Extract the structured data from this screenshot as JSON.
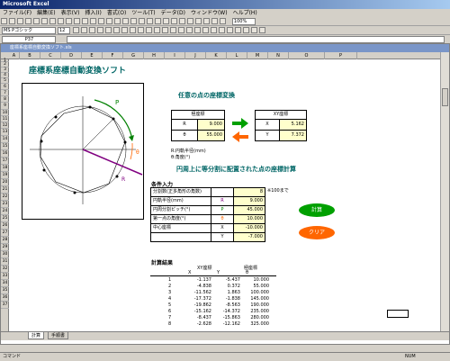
{
  "window": {
    "title": "Microsoft Excel",
    "doc_title": "座標系座標自動変換ソフト.xls"
  },
  "menu": [
    "ファイル(F)",
    "編集(E)",
    "表示(V)",
    "挿入(I)",
    "書式(O)",
    "ツール(T)",
    "データ(D)",
    "ウィンドウ(W)",
    "ヘルプ(H)"
  ],
  "toolbar": {
    "zoom": "100%",
    "font": "MS Pゴシック",
    "size": "12"
  },
  "formula": {
    "namebox": "P37",
    "value": ""
  },
  "columns": [
    "A",
    "B",
    "C",
    "D",
    "E",
    "F",
    "G",
    "H",
    "I",
    "J",
    "K",
    "L",
    "M",
    "N",
    "O",
    "P"
  ],
  "rows": [
    "1",
    "2",
    "3",
    "4",
    "5",
    "6",
    "7",
    "8",
    "9",
    "10",
    "11",
    "12",
    "13",
    "14",
    "15",
    "16",
    "17",
    "18",
    "19",
    "20",
    "21",
    "22",
    "23",
    "24",
    "25",
    "26",
    "27",
    "28",
    "29",
    "30",
    "31",
    "32",
    "33",
    "34",
    "35",
    "36",
    "37"
  ],
  "sheet": {
    "title": "座標系座標自動変換ソフト",
    "sec1": "任意の点の座標変換",
    "polar_hdr": "極座標",
    "xy_hdr": "XY座標",
    "r_label": "R",
    "r_val": "9.000",
    "theta_label": "θ",
    "theta_val": "55.000",
    "x_label": "X",
    "x_val": "5.162",
    "y_label": "Y",
    "y_val": "7.372",
    "note1": "R:円軌半径(mm)",
    "note2": "θ:角度(°)",
    "sec2": "円周上に等分割に配置された点の座標計算",
    "cond_title": "条件入力",
    "cond": [
      {
        "label": "分割数(正多角形の角数)",
        "sym": "",
        "val": "8"
      },
      {
        "label": "円軌半径(mm)",
        "sym": "R",
        "val": "9.000"
      },
      {
        "label": "円周分割ピッチ(°)",
        "sym": "P",
        "val": "45.000"
      },
      {
        "label": "第一点の角度(°)",
        "sym": "θ",
        "val": "10.000"
      },
      {
        "label": "中心座標",
        "sym": "X",
        "val": "-10.000"
      },
      {
        "label": "",
        "sym": "Y",
        "val": "-7.000"
      }
    ],
    "cond_note": "※100まで",
    "btn_calc": "計算",
    "btn_clear": "クリア",
    "res_title": "計算結果",
    "res_hdr_xy": "XY座標",
    "res_hdr_polar": "極座標",
    "res_sub": [
      "X",
      "Y",
      "θ"
    ],
    "results": [
      [
        "1",
        "-1.137",
        "-5.437",
        "10.000"
      ],
      [
        "2",
        "-4.838",
        "0.372",
        "55.000"
      ],
      [
        "3",
        "-11.562",
        "1.863",
        "100.000"
      ],
      [
        "4",
        "-17.372",
        "-1.838",
        "145.000"
      ],
      [
        "5",
        "-19.862",
        "-8.563",
        "190.000"
      ],
      [
        "6",
        "-15.162",
        "-14.372",
        "235.000"
      ],
      [
        "7",
        "-8.437",
        "-15.863",
        "280.000"
      ],
      [
        "8",
        "-2.628",
        "-12.162",
        "325.000"
      ]
    ],
    "diagram": {
      "label_p": "P",
      "label_theta": "θ",
      "label_r": "R"
    }
  },
  "tabs": [
    "計算",
    "手順書"
  ],
  "status": {
    "left": "コマンド",
    "right": "NUM"
  }
}
